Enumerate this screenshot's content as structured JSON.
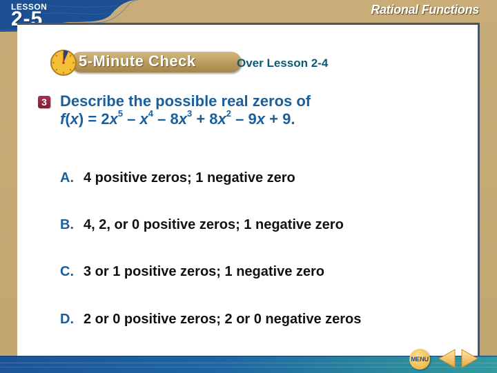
{
  "header": {
    "lesson_label": "LESSON",
    "lesson_number": "2-5",
    "title": "Rational Functions"
  },
  "banner": {
    "check_label": "5-Minute Check",
    "over_lesson": "Over Lesson 2-4"
  },
  "question": {
    "number": "3",
    "line1": "Describe the possible real zeros of",
    "function_name": "f",
    "variable": "x",
    "equation_parts": [
      "2",
      "5",
      "4",
      "8",
      "3",
      "8",
      "2",
      "9",
      "9"
    ]
  },
  "answers": [
    {
      "letter": "A.",
      "text": "4 positive zeros; 1 negative zero"
    },
    {
      "letter": "B.",
      "text": "4, 2, or 0 positive zeros; 1 negative zero"
    },
    {
      "letter": "C.",
      "text": "3 or 1 positive zeros; 1 negative zero"
    },
    {
      "letter": "D.",
      "text": "2 or 0 positive zeros; 2 or 0 negative zeros"
    }
  ],
  "nav": {
    "menu_label": "MENU",
    "prev_icon": "triangle-left",
    "next_icon": "triangle-right"
  },
  "colors": {
    "header_blue": "#1d4f93",
    "tan": "#c4a873",
    "accent_text": "#1b5f9a",
    "over_lesson": "#0f5a73",
    "badge": "#8a2440"
  }
}
